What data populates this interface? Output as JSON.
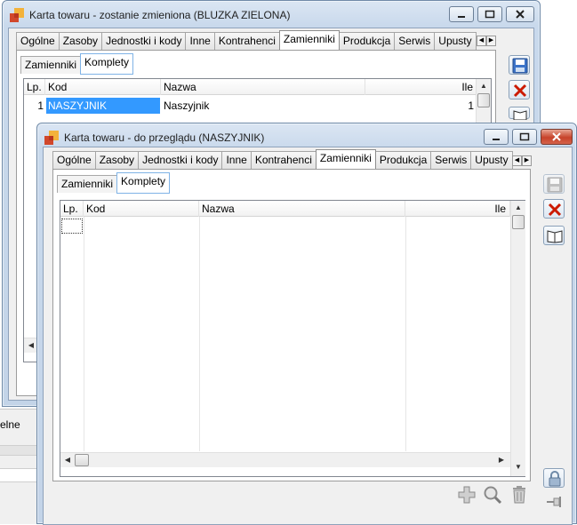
{
  "background_app": {
    "label": "elne"
  },
  "back_window": {
    "title": "Karta towaru - zostanie zmieniona (BLUZKA ZIELONA)",
    "tabs": [
      "Ogólne",
      "Zasoby",
      "Jednostki i kody",
      "Inne",
      "Kontrahenci",
      "Zamienniki",
      "Produkcja",
      "Serwis",
      "Upusty"
    ],
    "active_tab": "Zamienniki",
    "subtabs": [
      "Zamienniki",
      "Komplety"
    ],
    "active_subtab": "Komplety",
    "grid": {
      "columns": [
        "Lp.",
        "Kod",
        "Nazwa",
        "Ile"
      ],
      "rows": [
        {
          "lp": "1",
          "kod": "NASZYJNIK",
          "nazwa": "Naszyjnik",
          "ile": "1"
        }
      ]
    }
  },
  "front_window": {
    "title": "Karta towaru - do przeglądu (NASZYJNIK)",
    "tabs": [
      "Ogólne",
      "Zasoby",
      "Jednostki i kody",
      "Inne",
      "Kontrahenci",
      "Zamienniki",
      "Produkcja",
      "Serwis",
      "Upusty"
    ],
    "active_tab": "Zamienniki",
    "subtabs": [
      "Zamienniki",
      "Komplety"
    ],
    "active_subtab": "Komplety",
    "grid": {
      "columns": [
        "Lp.",
        "Kod",
        "Nazwa",
        "Ile"
      ],
      "rows": []
    },
    "side_buttons": [
      "save-icon",
      "close-icon",
      "book-icon"
    ],
    "bottom_buttons": [
      "add-icon",
      "search-icon",
      "delete-icon"
    ],
    "right_bottom_buttons": [
      "lock-icon",
      "pin-icon"
    ]
  },
  "colors": {
    "selection": "#3399ff",
    "close_button": "#c7432a",
    "delete_red": "#cc1a00"
  }
}
